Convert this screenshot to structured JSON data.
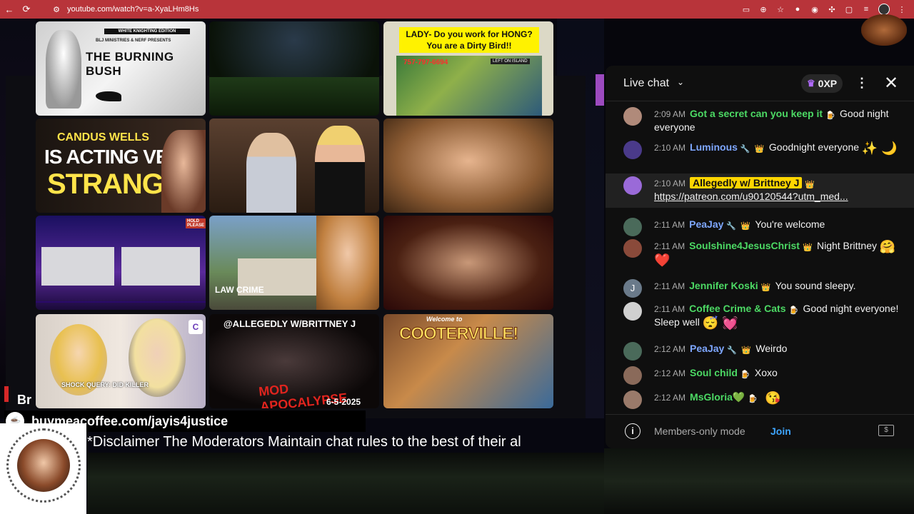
{
  "browser": {
    "url": "youtube.com/watch?v=a-XyaLHm8Hs",
    "back_icon": "←",
    "reload_icon": "⟳",
    "site_info_icon": "⚙"
  },
  "stream": {
    "tiles": {
      "t1_edition": "WHITE KNIGHTING EDITION",
      "t1_title": "THE BURNING BUSH",
      "t1_sub": "BLJ MINISTRIES & NERF PRESENTS",
      "t3_caption": "LADY- Do you work for HONG? You are a Dirty Bird!!",
      "t3_phone": "757-797-6694",
      "t3_island": "LEFT ON ISLAND",
      "t4_name": "CANDUS WELLS",
      "t4_line2": "IS ACTING VERY",
      "t4_line3": "STRANGE",
      "t7_hold": "HOLD PLEASE",
      "t8_law": "LAW CRIME",
      "t10_cap": "SHOCK QUERY: DID KILLER",
      "t11_handle": "@ALLEGEDLY W/BRITTNEY J",
      "t11_apoc": "MOD APOCALYPSE",
      "t11_date": "6-5-2025",
      "t12_welcome": "Welcome to",
      "t12_coot": "COOTERVILLE!"
    },
    "br_text": "Br",
    "coffee_url": "buymeacoffee.com/jayis4justice",
    "disclaimer": "*Disclaimer The Moderators Maintain chat rules to the best of their al"
  },
  "chat": {
    "title": "Live chat",
    "xp": "0XP",
    "messages": [
      {
        "time": "2:09 AM",
        "author": "Got a secret can you keep it",
        "badge": "🍺",
        "text": "Good night everyone",
        "avatar_color": "#b08a7a",
        "style": "green"
      },
      {
        "time": "2:10 AM",
        "author": "Luminous",
        "badge": "🔧",
        "badge2": "👑",
        "text": "Goodnight everyone",
        "emoji": "✨ 🌙",
        "avatar_color": "#4a3a8a",
        "style": "blue"
      },
      {
        "time": "2:10 AM",
        "author": "Allegedly w/ Brittney J",
        "badge": "👑",
        "text": "https://patreon.com/u90120544?utm_med...",
        "avatar_color": "#9a6ad8",
        "style": "mod"
      },
      {
        "time": "2:11 AM",
        "author": "PeaJay",
        "badge": "🔧",
        "badge2": "👑",
        "text": "You're welcome",
        "avatar_color": "#4a6a5a",
        "style": "blue"
      },
      {
        "time": "2:11 AM",
        "author": "Soulshine4JesusChrist",
        "badge": "👑",
        "text": "Night Brittney",
        "emoji": "🤗 ❤️",
        "avatar_color": "#8a4a3a",
        "style": "green"
      },
      {
        "time": "2:11 AM",
        "author": "Jennifer Koski",
        "badge": "👑",
        "text": "You sound sleepy.",
        "avatar_letter": "J",
        "avatar_color": "#6a7a8a",
        "style": "green"
      },
      {
        "time": "2:11 AM",
        "author": "Coffee Crime & Cats",
        "badge": "🍺",
        "text": "Good night everyone! Sleep well",
        "emoji": "😴 💓",
        "avatar_color": "#d0d0d0",
        "style": "green"
      },
      {
        "time": "2:12 AM",
        "author": "PeaJay",
        "badge": "🔧",
        "badge2": "👑",
        "text": "Weirdo",
        "avatar_color": "#4a6a5a",
        "style": "blue"
      },
      {
        "time": "2:12 AM",
        "author": "Soul child",
        "badge": "🍺",
        "text": "Xoxo",
        "avatar_color": "#8a6a5a",
        "style": "green"
      },
      {
        "time": "2:12 AM",
        "author": "MsGloria💚",
        "badge": "🍺",
        "text": "",
        "emoji": "😘",
        "avatar_color": "#9a7a6a",
        "style": "green"
      }
    ],
    "members_only": "Members-only mode",
    "join": "Join"
  }
}
